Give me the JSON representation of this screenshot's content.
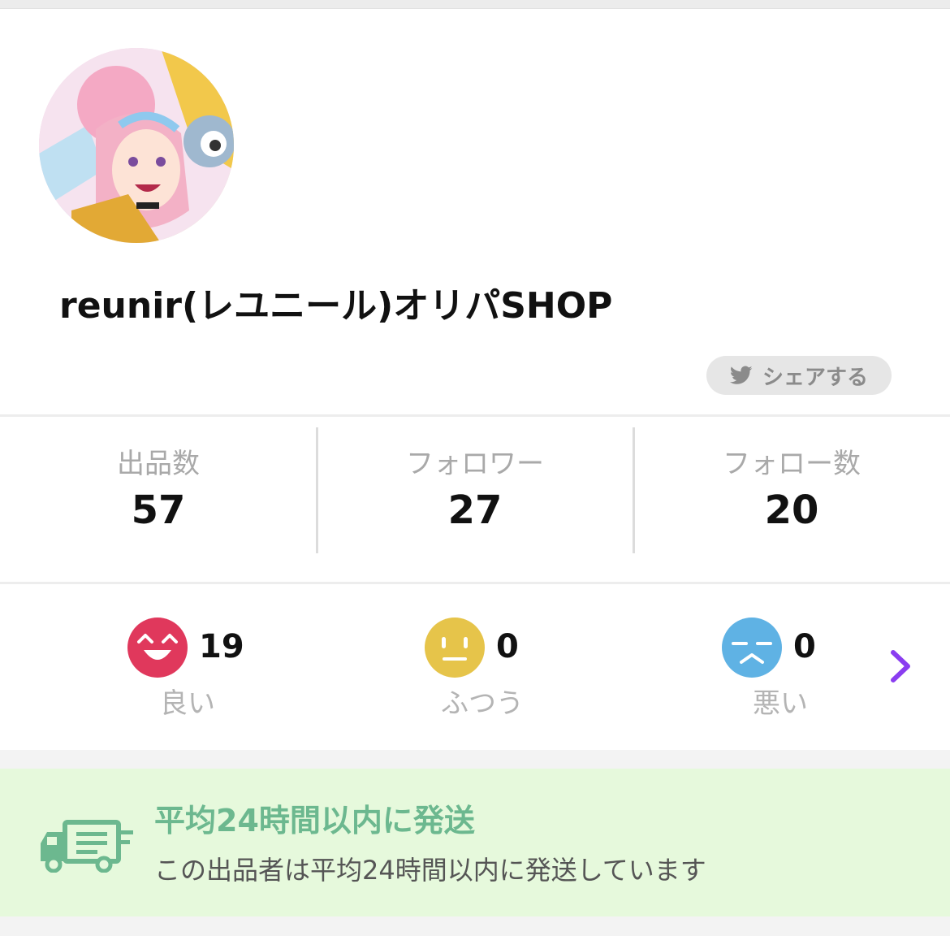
{
  "profile": {
    "shop_name": "reunir(レユニール)オリパSHOP",
    "avatar_alt": "avatar"
  },
  "share": {
    "label": "シェアする",
    "icon": "twitter-bird-icon"
  },
  "stats": [
    {
      "label": "出品数",
      "value": "57"
    },
    {
      "label": "フォロワー",
      "value": "27"
    },
    {
      "label": "フォロー数",
      "value": "20"
    }
  ],
  "ratings": [
    {
      "label": "良い",
      "count": "19",
      "icon": "smile-face-icon",
      "color": "#e0385c"
    },
    {
      "label": "ふつう",
      "count": "0",
      "icon": "neutral-face-icon",
      "color": "#e6c44a"
    },
    {
      "label": "悪い",
      "count": "0",
      "icon": "sad-face-icon",
      "color": "#5fb2e4"
    }
  ],
  "ratings_more_icon": "chevron-right-icon",
  "shipping": {
    "title": "平均24時間以内に発送",
    "description": "この出品者は平均24時間以内に発送しています",
    "icon": "delivery-truck-icon",
    "accent": "#6cb88f",
    "background": "#e6f9dc"
  },
  "colors": {
    "accent_purple": "#8a3df0"
  }
}
